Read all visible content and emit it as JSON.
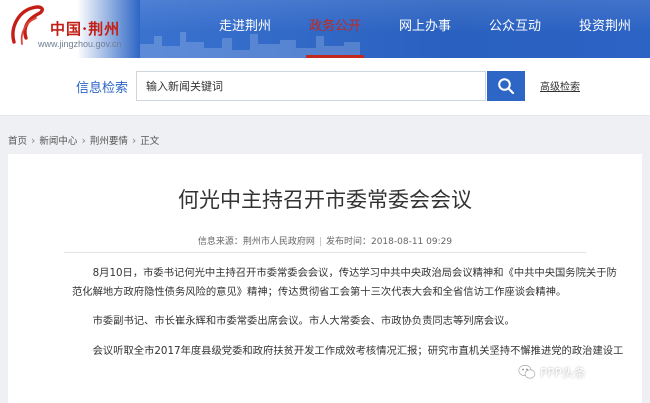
{
  "site": {
    "logo_text": "中国·荆州",
    "logo_url": "www.jingzhou.gov.cn"
  },
  "nav": [
    {
      "label": "走进荆州",
      "active": false
    },
    {
      "label": "政务公开",
      "active": true
    },
    {
      "label": "网上办事",
      "active": false
    },
    {
      "label": "公众互动",
      "active": false
    },
    {
      "label": "投资荆州",
      "active": false
    }
  ],
  "search": {
    "label": "信息检索",
    "placeholder": "输入新闻关键词",
    "advanced_label": "高级检索"
  },
  "breadcrumb": [
    "首页",
    "新闻中心",
    "荆州要情",
    "正文"
  ],
  "article": {
    "title": "何光中主持召开市委常委会会议",
    "source_label": "信息来源：",
    "source": "荆州市人民政府网",
    "date_label": "发布时间：",
    "date": "2018-08-11 09:29",
    "paragraphs": [
      "8月10日，市委书记何光中主持召开市委常委会会议，传达学习中共中央政治局会议精神和《中共中央国务院关于防",
      "范化解地方政府隐性债务风险的意见》精神；传达贯彻省工会第十三次代表大会和全省信访工作座谈会精神。",
      "市委副书记、市长崔永辉和市委常委出席会议。市人大常委会、市政协负责同志等列席会议。",
      "会议听取全市2017年度县级党委和政府扶贫开发工作成效考核情况汇报；研究市直机关坚持不懈推进党的政治建设工"
    ]
  },
  "watermark": {
    "text": "PPP头条",
    "icon": "wechat-icon"
  },
  "colors": {
    "header_blue": "#2d66c5",
    "active_red": "#c2281d",
    "logo_red": "#c41f16"
  }
}
